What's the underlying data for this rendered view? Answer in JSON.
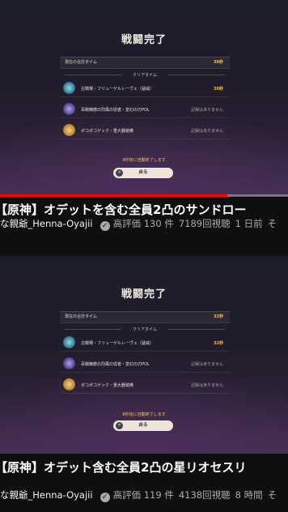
{
  "cards": [
    {
      "screen_title": "戦闘完了",
      "total_label": "現在の合計タイム",
      "total_time": "30秒",
      "clear_label": "クリアタイム",
      "stages": [
        {
          "name": "古戦場・フリューゲルレーヴェ（猛威）",
          "time": "30秒",
          "icon": "hydro-boss-icon"
        },
        {
          "name": "百戦錬磨の烈風の従者・変幻の刃POL",
          "time": "記録はありません",
          "icon": "anemo-boss-icon"
        },
        {
          "name": "ポコポコゲック・重大器装備",
          "time": "記録はありません",
          "icon": "pyro-boss-icon"
        }
      ],
      "auto_close": "8秒後に自動終了します",
      "back_label": "戻る",
      "progress": 0.79,
      "title": "【原神】オデットを含む全員2凸のサンドロー",
      "channel": "な親爺_Henna-Oyajii",
      "likes": "高評価 130 件",
      "views": "7189回視聴",
      "age": "1 日前",
      "more": "そ"
    },
    {
      "screen_title": "戦闘完了",
      "total_label": "現在の合計タイム",
      "total_time": "32秒",
      "clear_label": "クリアタイム",
      "stages": [
        {
          "name": "古戦場・フリューゲルレーヴェ（猛威）",
          "time": "32秒",
          "icon": "hydro-boss-icon"
        },
        {
          "name": "百戦錬磨の烈風の従者・変幻の刃POL",
          "time": "記録はありません",
          "icon": "anemo-boss-icon"
        },
        {
          "name": "ポコポコゲック・重大器装備",
          "time": "記録はありません",
          "icon": "pyro-boss-icon"
        }
      ],
      "auto_close": "8秒後に自動終了します",
      "back_label": "戻る",
      "progress": 0.0,
      "title": "【原神】オデット含む全員2凸の星リオセスリ",
      "channel": "な親爺_Henna-Oyajii",
      "likes": "高評価 119 件",
      "views": "4138回視聴",
      "age": "8 時間",
      "more": "そ"
    }
  ],
  "colors": {
    "accent_gold": "#f5c24e",
    "progress_red": "#ff0000",
    "background": "#0f0f0f"
  }
}
